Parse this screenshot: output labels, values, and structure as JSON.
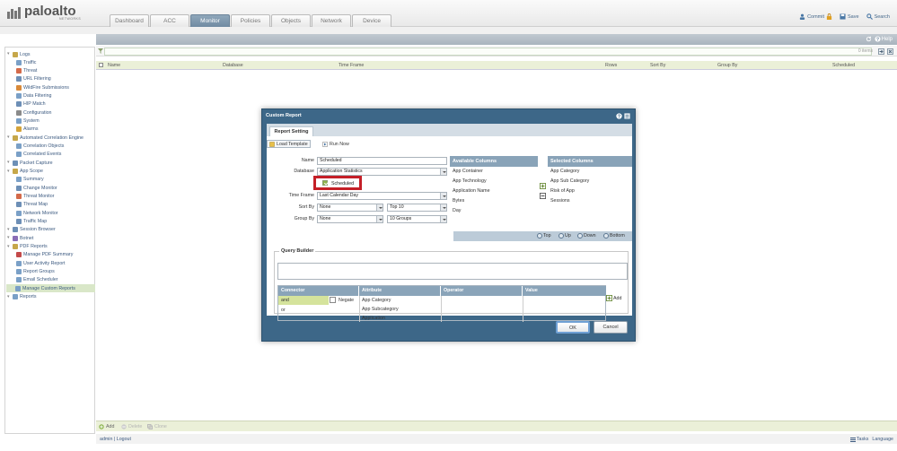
{
  "app": {
    "logo_text": "paloalto",
    "logo_sub": "NETWORKS",
    "tabs": [
      "Dashboard",
      "ACC",
      "Monitor",
      "Policies",
      "Objects",
      "Network",
      "Device"
    ],
    "active_tab": "Monitor",
    "header_actions": {
      "commit": "Commit",
      "save": "Save",
      "search": "Search"
    }
  },
  "sidebar": {
    "items": [
      {
        "label": "Logs",
        "level": 0,
        "icon": "folder-icon"
      },
      {
        "label": "Traffic",
        "level": 1,
        "icon": "traffic-icon"
      },
      {
        "label": "Threat",
        "level": 1,
        "icon": "threat-icon"
      },
      {
        "label": "URL Filtering",
        "level": 1,
        "icon": "url-icon"
      },
      {
        "label": "WildFire Submissions",
        "level": 1,
        "icon": "wildfire-icon"
      },
      {
        "label": "Data Filtering",
        "level": 1,
        "icon": "data-filter-icon"
      },
      {
        "label": "HIP Match",
        "level": 1,
        "icon": "hip-icon"
      },
      {
        "label": "Configuration",
        "level": 1,
        "icon": "config-icon"
      },
      {
        "label": "System",
        "level": 1,
        "icon": "system-icon"
      },
      {
        "label": "Alarms",
        "level": 1,
        "icon": "alarm-icon"
      },
      {
        "label": "Automated Correlation Engine",
        "level": 0,
        "icon": "folder-icon"
      },
      {
        "label": "Correlation Objects",
        "level": 1,
        "icon": "correlation-icon"
      },
      {
        "label": "Correlated Events",
        "level": 1,
        "icon": "events-icon"
      },
      {
        "label": "Packet Capture",
        "level": 0,
        "icon": "capture-icon"
      },
      {
        "label": "App Scope",
        "level": 0,
        "icon": "folder-icon"
      },
      {
        "label": "Summary",
        "level": 1,
        "icon": "summary-icon"
      },
      {
        "label": "Change Monitor",
        "level": 1,
        "icon": "change-icon"
      },
      {
        "label": "Threat Monitor",
        "level": 1,
        "icon": "threat-monitor-icon"
      },
      {
        "label": "Threat Map",
        "level": 1,
        "icon": "map-icon"
      },
      {
        "label": "Network Monitor",
        "level": 1,
        "icon": "network-icon"
      },
      {
        "label": "Traffic Map",
        "level": 1,
        "icon": "map-icon"
      },
      {
        "label": "Session Browser",
        "level": 0,
        "icon": "browser-icon"
      },
      {
        "label": "Botnet",
        "level": 0,
        "icon": "botnet-icon"
      },
      {
        "label": "PDF Reports",
        "level": 0,
        "icon": "folder-icon"
      },
      {
        "label": "Manage PDF Summary",
        "level": 1,
        "icon": "pdf-icon"
      },
      {
        "label": "User Activity Report",
        "level": 1,
        "icon": "user-report-icon"
      },
      {
        "label": "Report Groups",
        "level": 1,
        "icon": "report-group-icon"
      },
      {
        "label": "Email Scheduler",
        "level": 1,
        "icon": "email-icon"
      },
      {
        "label": "Manage Custom Reports",
        "level": 0,
        "icon": "custom-report-icon",
        "selected": true
      },
      {
        "label": "Reports",
        "level": 0,
        "icon": "reports-icon"
      }
    ]
  },
  "main": {
    "help": "Help",
    "items_count": "0 items",
    "columns": [
      "Name",
      "Database",
      "Time Frame",
      "Rows",
      "Sort By",
      "Group By",
      "Scheduled"
    ],
    "footer": {
      "add": "Add",
      "delete": "Delete",
      "clone": "Clone"
    },
    "status": {
      "user": "admin",
      "logout": "Logout",
      "tasks": "Tasks",
      "language": "Language"
    }
  },
  "modal": {
    "title": "Custom Report",
    "tab": "Report Setting",
    "load_template": "Load Template",
    "run_now": "Run Now",
    "labels": {
      "name": "Name",
      "database": "Database",
      "time_frame": "Time Frame",
      "sort_by": "Sort By",
      "group_by": "Group By"
    },
    "values": {
      "name": "Scheduled",
      "database": "Application Statistics",
      "scheduled_label": "Scheduled",
      "scheduled": true,
      "time_frame": "Last Calendar Day",
      "sort_by": "None",
      "sort_top": "Top 10",
      "group_by": "None",
      "group_count": "10 Groups"
    },
    "available_columns": {
      "title": "Available Columns",
      "items": [
        "App Container",
        "App Technology",
        "Application Name",
        "Bytes",
        "Day"
      ]
    },
    "selected_columns": {
      "title": "Selected Columns",
      "items": [
        "App Category",
        "App Sub Category",
        "Risk of App",
        "Sessions"
      ]
    },
    "move": {
      "top": "Top",
      "up": "Up",
      "down": "Down",
      "bottom": "Bottom"
    },
    "query_builder": {
      "title": "Query Builder",
      "headers": [
        "Connector",
        "Attribute",
        "Operator",
        "Value"
      ],
      "connectors": [
        "and",
        "or"
      ],
      "negate": "Negate",
      "attributes": [
        "App Category",
        "App Subcategory",
        "Application"
      ],
      "add": "Add"
    },
    "ok": "OK",
    "cancel": "Cancel"
  },
  "colors": {
    "accent": "#3d6788",
    "tab_active": "#7a93a9",
    "highlight": "#c41f27",
    "selection": "#d9e7c8"
  }
}
